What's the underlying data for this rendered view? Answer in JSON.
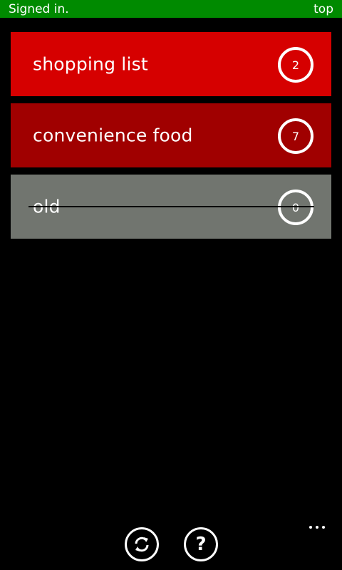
{
  "status_bar": {
    "left_text": "Signed in.",
    "right_text": "top",
    "background": "#008a00"
  },
  "lists": [
    {
      "name": "shopping list",
      "count": "2",
      "color": "#d60000",
      "completed": false
    },
    {
      "name": "convenience food",
      "count": "7",
      "color": "#a00000",
      "completed": false
    },
    {
      "name": "old",
      "count": "0",
      "color": "#71756f",
      "completed": true
    }
  ],
  "app_bar": {
    "buttons": [
      {
        "name": "sync-button",
        "icon": "sync-icon"
      },
      {
        "name": "help-button",
        "icon": "help-icon",
        "glyph": "?"
      }
    ],
    "more_icon": "more-dots-icon"
  }
}
